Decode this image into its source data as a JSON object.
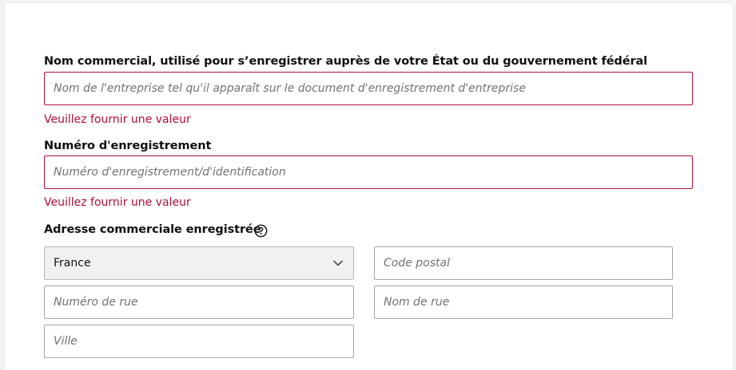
{
  "business_name": {
    "label": "Nom commercial, utilisé pour s’enregistrer auprès de votre État ou du gouvernement fédéral",
    "placeholder": "Nom de l'entreprise tel qu'il apparaît sur le document d'enregistrement d'entreprise",
    "error": "Veuillez fournir une valeur"
  },
  "registration_number": {
    "label": "Numéro d'enregistrement",
    "placeholder": "Numéro d'enregistrement/d'identification",
    "error": "Veuillez fournir une valeur"
  },
  "address": {
    "label": "Adresse commerciale enregistrée",
    "help_icon": "question-circle-icon",
    "country_value": "France",
    "postal_code_placeholder": "Code postal",
    "street_number_placeholder": "Numéro de rue",
    "street_name_placeholder": "Nom de rue",
    "city_placeholder": "Ville"
  },
  "colors": {
    "error": "#b30d36",
    "text": "#0f1111",
    "placeholder": "#6f7373"
  }
}
